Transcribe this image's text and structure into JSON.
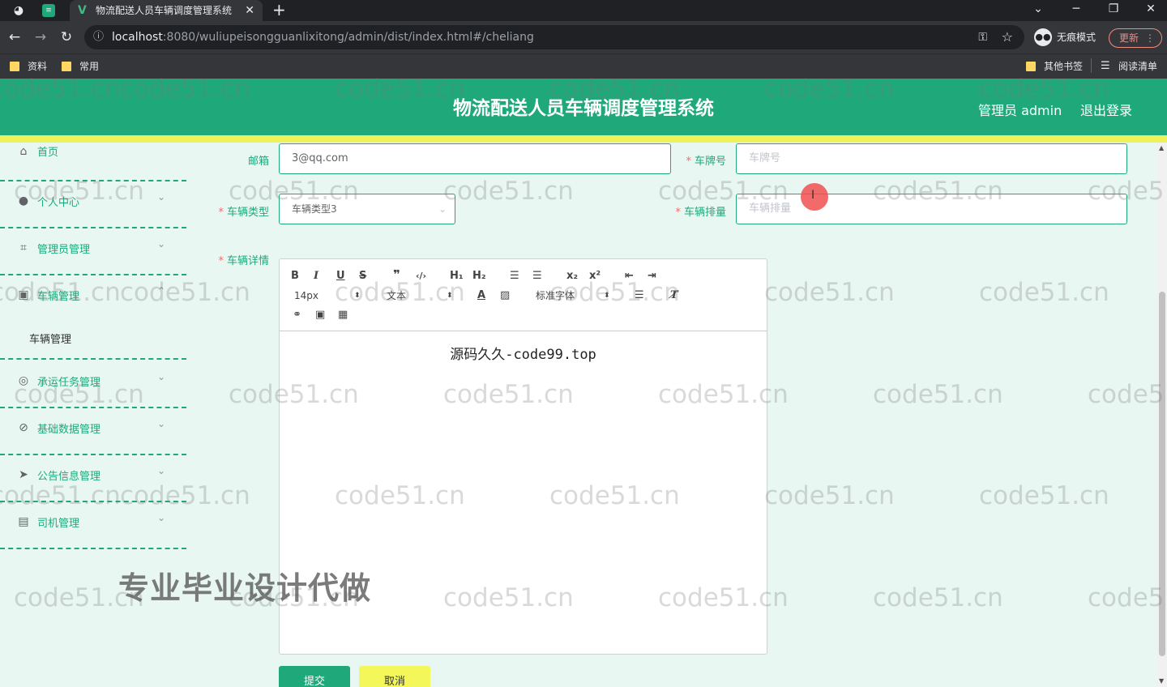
{
  "browser": {
    "tab_title": "物流配送人员车辆调度管理系统",
    "url_host": "localhost",
    "url_rest": ":8080/wuliupeisongguanlixitong/admin/dist/index.html#/cheliang",
    "incognito_label": "无痕模式",
    "update_label": "更新",
    "bookmarks": [
      "资料",
      "常用"
    ],
    "bookmarks_right": [
      "其他书签",
      "阅读清单"
    ]
  },
  "header": {
    "title": "物流配送人员车辆调度管理系统",
    "user": "管理员 admin",
    "logout": "退出登录"
  },
  "sidebar": {
    "items": [
      {
        "label": "首页",
        "icon": "home-icon"
      },
      {
        "label": "个人中心",
        "icon": "user-icon"
      },
      {
        "label": "管理员管理",
        "icon": "crop-icon"
      },
      {
        "label": "车辆管理",
        "icon": "car-icon"
      },
      {
        "label": "车辆管理",
        "icon": ""
      },
      {
        "label": "承运任务管理",
        "icon": "task-icon"
      },
      {
        "label": "基础数据管理",
        "icon": "compass-icon"
      },
      {
        "label": "公告信息管理",
        "icon": "send-icon"
      },
      {
        "label": "司机管理",
        "icon": "document-icon"
      }
    ]
  },
  "form": {
    "email_label": "邮箱",
    "email_value": "3@qq.com",
    "plate_label": "车牌号",
    "plate_placeholder": "车牌号",
    "type_label": "车辆类型",
    "type_value": "车辆类型3",
    "displacement_label": "车辆排量",
    "displacement_placeholder": "车辆排量",
    "details_label": "车辆详情",
    "editor_font_size": "14px",
    "editor_header": "文本",
    "editor_font": "标准字体",
    "editor_content": "源码久久-code99.top",
    "submit": "提交",
    "cancel": "取消"
  },
  "overlay": {
    "watermark": "code51.cn",
    "promo": "专业毕业设计代做"
  }
}
